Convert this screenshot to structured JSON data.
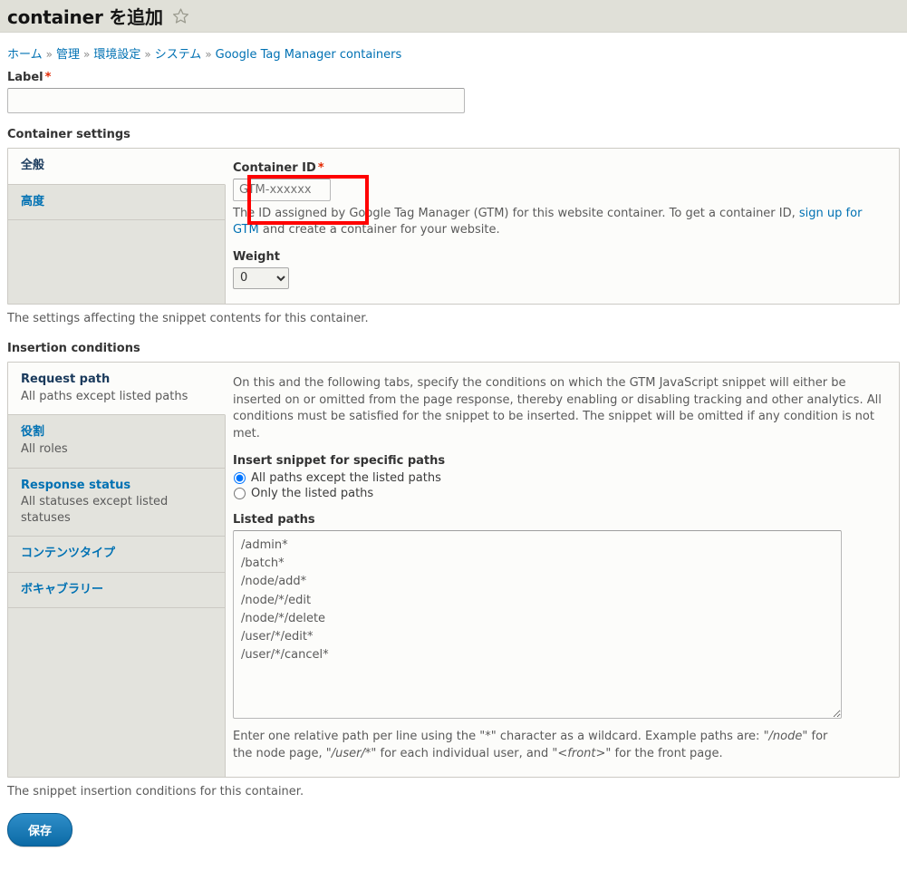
{
  "header": {
    "title": "container を追加",
    "star_icon": "star-outline-icon"
  },
  "breadcrumb": {
    "items": [
      "ホーム",
      "管理",
      "環境設定",
      "システム",
      "Google Tag Manager containers"
    ],
    "separator": "»"
  },
  "label_field": {
    "label": "Label",
    "required_mark": "*",
    "value": "",
    "placeholder": ""
  },
  "container_settings": {
    "section_title": "Container settings",
    "tabs": [
      {
        "title": "全般",
        "summary": "",
        "active": true
      },
      {
        "title": "高度",
        "summary": "",
        "active": false
      }
    ],
    "container_id": {
      "label": "Container ID",
      "required_mark": "*",
      "value": "",
      "placeholder": "GTM-xxxxxx",
      "description_pre": "The ID assigned by Google Tag Manager (GTM) for this website container. To get a container ID, ",
      "description_link": "sign up for GTM",
      "description_post": " and create a container for your website."
    },
    "weight": {
      "label": "Weight",
      "value": "0",
      "options": [
        "0"
      ]
    },
    "footer_note": "The settings affecting the snippet contents for this container."
  },
  "insertion_conditions": {
    "section_title": "Insertion conditions",
    "tabs": [
      {
        "title": "Request path",
        "summary": "All paths except listed paths",
        "active": true
      },
      {
        "title": "役割",
        "summary": "All roles",
        "active": false
      },
      {
        "title": "Response status",
        "summary": "All statuses except listed statuses",
        "active": false
      },
      {
        "title": "コンテンツタイプ",
        "summary": "",
        "active": false
      },
      {
        "title": "ボキャブラリー",
        "summary": "",
        "active": false
      }
    ],
    "intro": "On this and the following tabs, specify the conditions on which the GTM JavaScript snippet will either be inserted on or omitted from the page response, thereby enabling or disabling tracking and other analytics. All conditions must be satisfied for the snippet to be inserted. The snippet will be omitted if any condition is not met.",
    "radio_group_label": "Insert snippet for specific paths",
    "radios": [
      {
        "label": "All paths except the listed paths",
        "checked": true
      },
      {
        "label": "Only the listed paths",
        "checked": false
      }
    ],
    "listed_paths_label": "Listed paths",
    "listed_paths_value": "/admin*\n/batch*\n/node/add*\n/node/*/edit\n/node/*/delete\n/user/*/edit*\n/user/*/cancel*",
    "paths_help_1": "Enter one relative path per line using the \"*\" character as a wildcard. Example paths are: \"",
    "paths_help_em1": "/node",
    "paths_help_2": "\" for the node page, \"",
    "paths_help_em2": "/user/*",
    "paths_help_3": "\" for each individual user, and \"",
    "paths_help_em3": "<front>",
    "paths_help_4": "\" for the front page.",
    "footer_note": "The snippet insertion conditions for this container."
  },
  "actions": {
    "save_label": "保存"
  },
  "colors": {
    "link": "#0071b3",
    "required": "#e32700",
    "annotation": "#ff0000",
    "header_bg": "#e0e0d8",
    "button": "#1074b3"
  }
}
